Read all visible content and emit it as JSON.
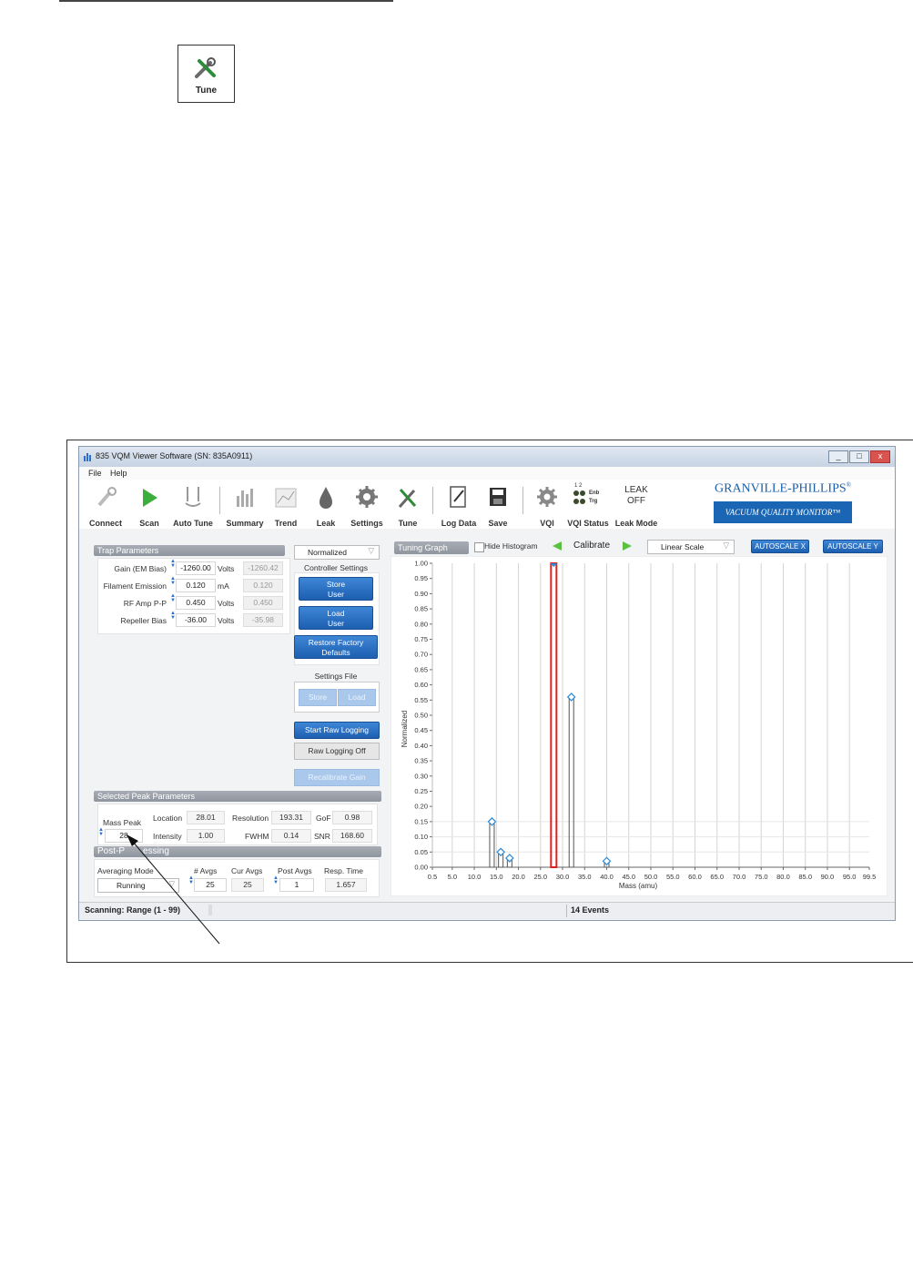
{
  "tune_icon_box": {
    "label": "Tune"
  },
  "window": {
    "title": "835 VQM Viewer Software (SN: 835A0911)",
    "controls": [
      "_",
      "□",
      "x"
    ]
  },
  "menu": [
    "File",
    "Help"
  ],
  "toolbar": {
    "items": [
      "Connect",
      "Scan",
      "Auto Tune",
      "Summary",
      "Trend",
      "Leak",
      "Settings",
      "Tune",
      "Log Data",
      "Save",
      "VQI",
      "VQI Status",
      "Leak Mode"
    ],
    "vqi_status": {
      "top": "1 2",
      "enb": "Enb",
      "trg": "Trg"
    },
    "leak_mode": {
      "line1": "LEAK",
      "line2": "OFF"
    },
    "brand": "GRANVILLE-PHILLIPS",
    "brand_mark": "®",
    "brand_sub": "VACUUM QUALITY MONITOR™"
  },
  "trap": {
    "header": "Trap Parameters",
    "rows": [
      {
        "label": "Gain (EM Bias)",
        "value": "-1260.00",
        "unit": "Volts",
        "readback": "-1260.42"
      },
      {
        "label": "Filament Emission",
        "value": "0.120",
        "unit": "mA",
        "readback": "0.120"
      },
      {
        "label": "RF Amp P-P",
        "value": "0.450",
        "unit": "Volts",
        "readback": "0.450"
      },
      {
        "label": "Repeller Bias",
        "value": "-36.00",
        "unit": "Volts",
        "readback": "-35.98"
      }
    ]
  },
  "controller": {
    "mode": "Normalized",
    "header": "Controller Settings",
    "store_user": [
      "Store",
      "User"
    ],
    "load_user": [
      "Load",
      "User"
    ],
    "restore": [
      "Restore Factory",
      "Defaults"
    ],
    "settings_file": "Settings File",
    "store": "Store",
    "load": "Load",
    "start_raw": "Start Raw Logging",
    "raw_off": "Raw Logging Off",
    "recalibrate": "Recalibrate Gain"
  },
  "peak": {
    "header": "Selected Peak Parameters",
    "mass_peak_label": "Mass Peak",
    "mass_peak_value": "28",
    "location_label": "Location",
    "location": "28.01",
    "resolution_label": "Resolution",
    "resolution": "193.31",
    "gof_label": "GoF",
    "gof": "0.98",
    "intensity_label": "Intensity",
    "intensity": "1.00",
    "fwhm_label": "FWHM",
    "fwhm": "0.14",
    "snr_label": "SNR",
    "snr": "168.60"
  },
  "post": {
    "header_visible": "Post-P",
    "header_tail": "essing",
    "averaging_mode_label": "Averaging Mode",
    "averaging_mode": "Running",
    "avgs_label": "# Avgs",
    "avgs": "25",
    "cur_avgs_label": "Cur Avgs",
    "cur_avgs": "25",
    "post_avgs_label": "Post Avgs",
    "post_avgs": "1",
    "resp_label": "Resp. Time",
    "resp": "1.657"
  },
  "graph": {
    "tab": "Tuning Graph",
    "hide_histogram": "Hide Histogram",
    "calibrate": "Calibrate",
    "scale": "Linear Scale",
    "autoscale_x": "AUTOSCALE X",
    "autoscale_y": "AUTOSCALE Y"
  },
  "chart_data": {
    "type": "line",
    "xlabel": "Mass (amu)",
    "ylabel": "Normalized",
    "xlim": [
      0.5,
      99.5
    ],
    "ylim": [
      0.0,
      1.0
    ],
    "x_ticks": [
      "0.5",
      "5.0",
      "10.0",
      "15.0",
      "20.0",
      "25.0",
      "30.0",
      "35.0",
      "40.0",
      "45.0",
      "50.0",
      "55.0",
      "60.0",
      "65.0",
      "70.0",
      "75.0",
      "80.0",
      "85.0",
      "90.0",
      "95.0",
      "99.5"
    ],
    "y_ticks": [
      "0.00",
      "0.05",
      "0.10",
      "0.15",
      "0.20",
      "0.25",
      "0.30",
      "0.35",
      "0.40",
      "0.45",
      "0.50",
      "0.55",
      "0.60",
      "0.65",
      "0.70",
      "0.75",
      "0.80",
      "0.85",
      "0.90",
      "0.95",
      "1.00"
    ],
    "grid": true,
    "peaks": [
      {
        "x": 14.0,
        "y": 0.15,
        "label": true
      },
      {
        "x": 16.0,
        "y": 0.05,
        "label": true
      },
      {
        "x": 18.0,
        "y": 0.03,
        "label": true
      },
      {
        "x": 28.0,
        "y": 1.0,
        "label": true,
        "selected": true
      },
      {
        "x": 32.0,
        "y": 0.56,
        "label": true
      },
      {
        "x": 40.0,
        "y": 0.02,
        "label": true
      }
    ]
  },
  "status": {
    "left": "Scanning: Range (1 - 99)",
    "events": "14 Events"
  },
  "colors": {
    "accent": "#1d5fb0",
    "selected_peak": "#e02020",
    "marker": "#2a8ad8"
  }
}
